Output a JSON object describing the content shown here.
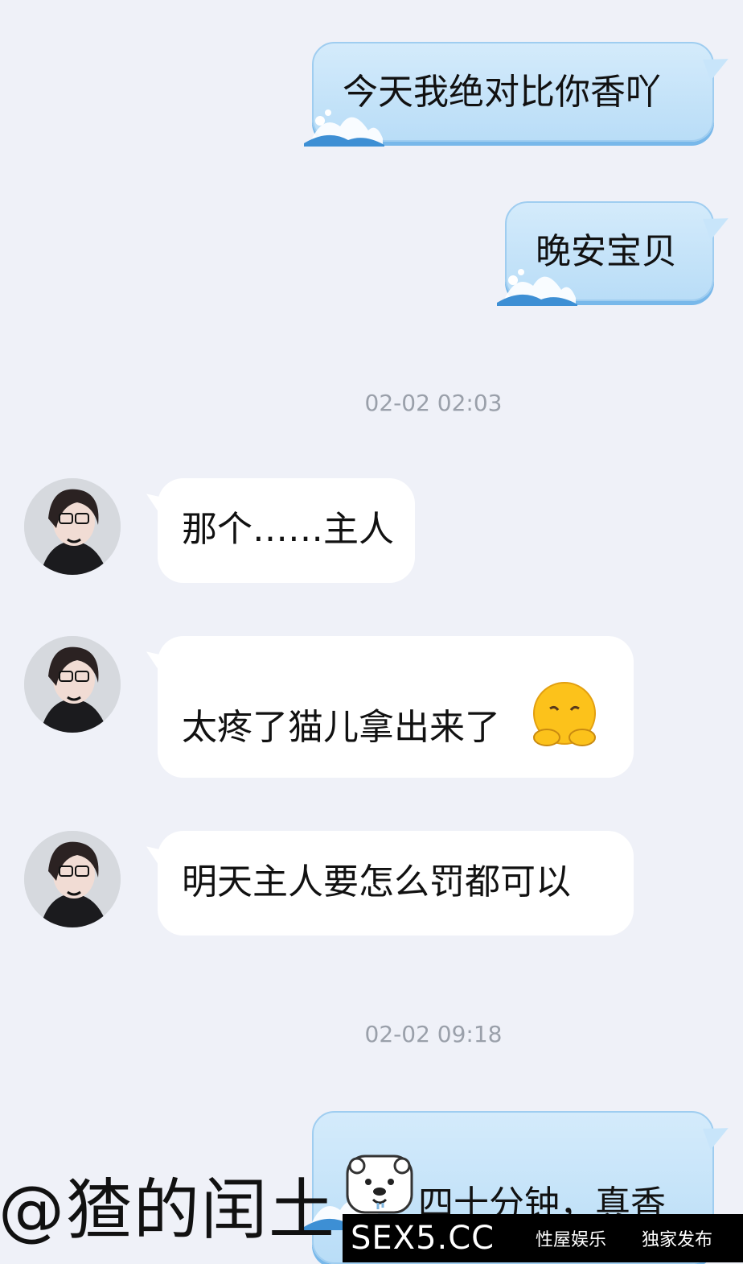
{
  "messages": {
    "m1": {
      "text": "今天我绝对比你香吖"
    },
    "m2": {
      "text": "晚安宝贝"
    },
    "ts1": "02-02 02:03",
    "m3": {
      "text": "那个……主人"
    },
    "m4": {
      "text": "太疼了猫儿拿出来了"
    },
    "m5": {
      "text": "明天主人要怎么罚都可以"
    },
    "ts2": "02-02 09:18",
    "m6": {
      "text": "四十分钟，真香"
    }
  },
  "watermark": {
    "text": "@猹的闰土"
  },
  "footer": {
    "logo": "SEX5.CC",
    "link1": "性屋娱乐",
    "link2": "独家发布"
  },
  "icons": {
    "avatar": "avatar-girl-glasses",
    "emoji": "pleading-hands-emoji",
    "sticker": "polar-bear-sticker",
    "wave": "wave-decoration"
  },
  "colors": {
    "background": "#eff1f8",
    "outgoing_bubble": "#c8e5fa",
    "incoming_bubble": "#ffffff",
    "timestamp": "#9aa0aa",
    "footer_bar": "#000000"
  }
}
